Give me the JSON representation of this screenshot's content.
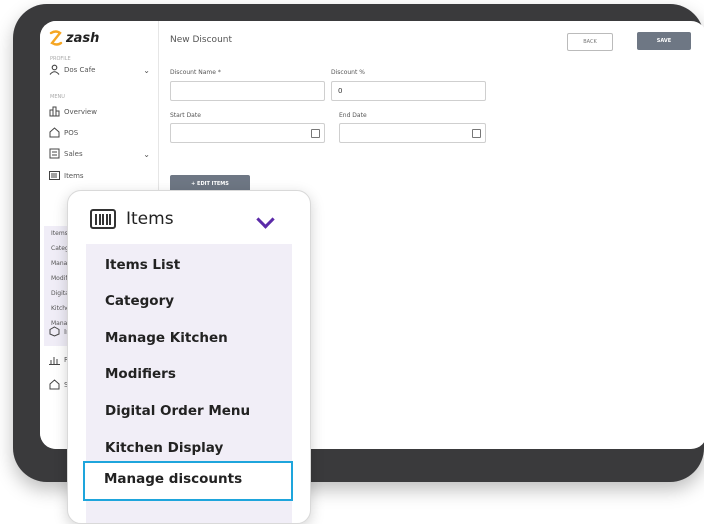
{
  "app": {
    "brand": "zash",
    "brand_color": "#f5a623",
    "accent": "#5b2aa8",
    "highlight_color": "#1ea5dc"
  },
  "sidebar": {
    "section_profile": "PROFILE",
    "store": "Dos Cafe",
    "section_menu": "MENU",
    "items": [
      {
        "label": "Overview",
        "icon": "overview-icon"
      },
      {
        "label": "POS",
        "icon": "home-icon"
      },
      {
        "label": "Sales",
        "icon": "sales-icon"
      },
      {
        "label": "Items",
        "icon": "barcode-icon"
      },
      {
        "label": "Inv",
        "icon": "inventory-icon"
      },
      {
        "label": "Rep",
        "icon": "reports-icon"
      },
      {
        "label": "Sto",
        "icon": "store-icon"
      }
    ],
    "sub_items": [
      "Items l",
      "Categ",
      "Manag",
      "Modifi",
      "Digital",
      "Kitche",
      "Manag"
    ]
  },
  "header": {
    "title": "New Discount",
    "back_label": "BACK",
    "save_label": "SAVE"
  },
  "form": {
    "name_label": "Discount Name *",
    "name_value": "",
    "percent_label": "Discount %",
    "percent_value": "0",
    "start_label": "Start Date",
    "end_label": "End Date",
    "edit_items_label": "+ EDIT ITEMS"
  },
  "popup": {
    "title": "Items",
    "items": [
      "Items List",
      "Category",
      "Manage Kitchen",
      "Modifiers",
      "Digital Order Menu",
      "Kitchen Display",
      "Manage discounts"
    ]
  }
}
